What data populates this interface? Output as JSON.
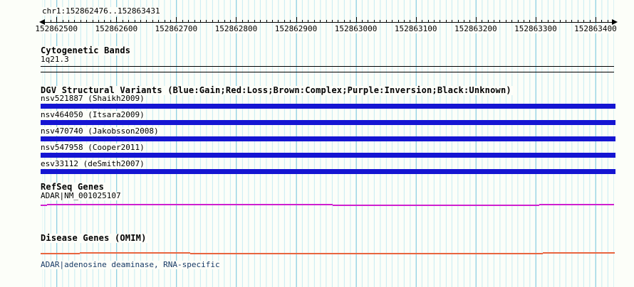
{
  "window": {
    "bg": "#fcfef9"
  },
  "region": {
    "title": "chr1:152862476..152863431",
    "chrom": "chr1",
    "start": 152862476,
    "end": 152863431
  },
  "ruler": {
    "major_ticks": [
      "152862500",
      "152862600",
      "152862700",
      "152862800",
      "152862900",
      "152863000",
      "152863100",
      "152863200",
      "152863300",
      "152863400"
    ],
    "minor_tick_interval_bp": 10
  },
  "grid": {
    "minor_color": "#c7ecf2",
    "major_color": "#7cc6dd"
  },
  "tracks": {
    "cytoband": {
      "header": "Cytogenetic Bands",
      "band": "1q21.3"
    },
    "dgv": {
      "header": "DGV Structural Variants (Blue:Gain;Red:Loss;Brown:Complex;Purple:Inversion;Black:Unknown)",
      "bar_color": "#1515d2",
      "variants": [
        "nsv521887 (Shaikh2009)",
        "nsv464050 (Itsara2009)",
        "nsv470740 (Jakobsson2008)",
        "nsv547958 (Cooper2011)",
        "esv33112 (deSmith2007)"
      ]
    },
    "refseq": {
      "header": "RefSeq Genes",
      "gene": "ADAR|NM_001025107",
      "color": "#cf1fcf"
    },
    "omim": {
      "header": "Disease Genes (OMIM)",
      "gene": "ADAR|adenosine deaminase, RNA-specific",
      "color": "#e8653f",
      "label_color": "#173a66"
    }
  }
}
